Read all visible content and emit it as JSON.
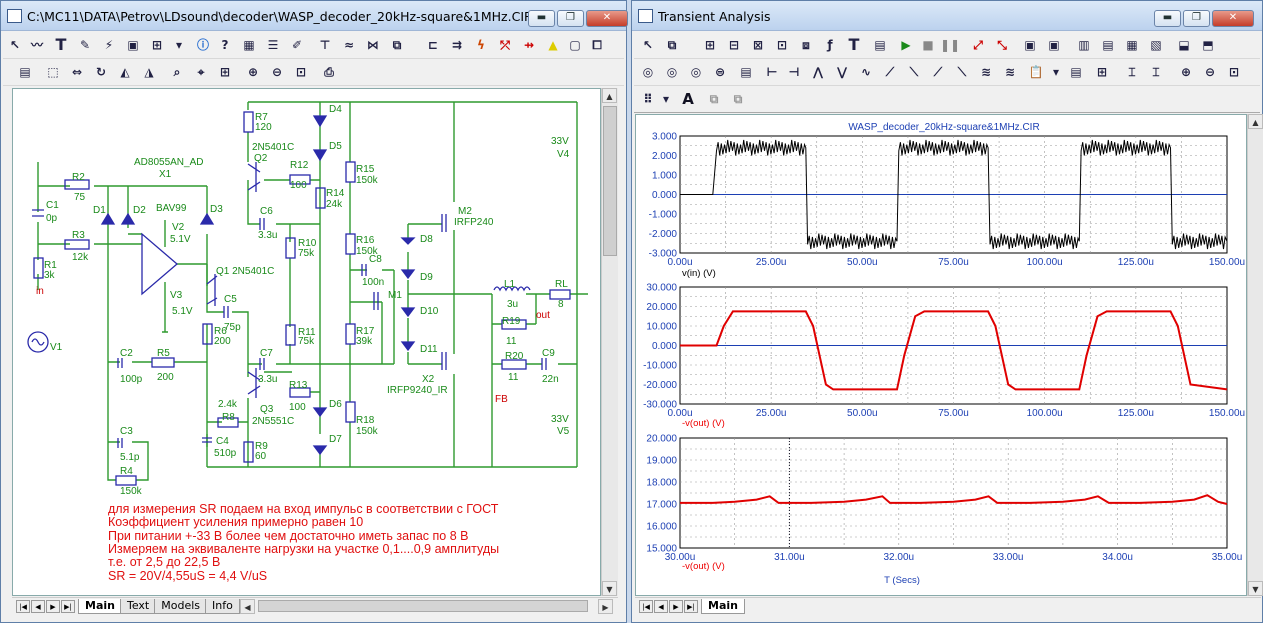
{
  "left_window": {
    "title": "C:\\MC11\\DATA\\Petrov\\LDsound\\decoder\\WASP_decoder_20kHz-square&1MHz.CIR",
    "tabs": [
      "Main",
      "Text",
      "Models",
      "Info"
    ],
    "controls": {
      "minimize": "▬",
      "restore": "❐",
      "close": "✕"
    },
    "labels": {
      "ad8055": "AD8055AN_AD",
      "x1": "X1",
      "r2": "R2",
      "r2v": "75",
      "c1": "C1",
      "c1v": "0p",
      "r3": "R3",
      "r3v": "12k",
      "r1": "R1",
      "r1v": "3k",
      "in": "in",
      "d1": "D1",
      "d2": "D2",
      "bav": "BAV99",
      "d3": "D3",
      "v2": "V2",
      "v2v": "5.1V",
      "v3": "V3",
      "v3v": "5.1V",
      "v1": "V1",
      "q1": "Q1 2N5401C",
      "r7": "R7",
      "r7v": "120",
      "q2": "Q2",
      "q2t": "2N5401C",
      "r12": "R12",
      "r12v": "100",
      "d4": "D4",
      "d5": "D5",
      "r15": "R15",
      "r15v": "150k",
      "r14": "R14",
      "r14v": "24k",
      "c6": "C6",
      "c6v": "3.3u",
      "r10": "R10",
      "r10v": "75k",
      "r16": "R16",
      "r16v": "150k",
      "c8": "C8",
      "c8v": "100n",
      "m1": "M1",
      "r17": "R17",
      "r17v": "39k",
      "r11": "R11",
      "r11v": "75k",
      "c5": "C5",
      "c5v": "75p",
      "r6": "R6",
      "r6v": "200",
      "c2": "C2",
      "c2v": "100p",
      "r5": "R5",
      "r5v": "200",
      "c7": "C7",
      "c7v": "3.3u",
      "r13": "R13",
      "r13v": "100",
      "d6": "D6",
      "d7": "D7",
      "r18": "R18",
      "r18v": "150k",
      "r8": "R8",
      "r8v": "2.4k",
      "q3": "Q3",
      "q3t": "2N5551C",
      "c4": "C4",
      "c4v": "510p",
      "r9": "R9",
      "r9v": "60",
      "c3": "C3",
      "c3v": "5.1p",
      "r4": "R4",
      "r4v": "150k",
      "m2": "M2",
      "m2t": "IRFP240",
      "d8": "D8",
      "d9": "D9",
      "d10": "D10",
      "d11": "D11",
      "x2": "X2",
      "x2t": "IRFP9240_IR",
      "fb": "FB",
      "l1": "L1",
      "l1v": "3u",
      "rl": "RL",
      "rlv": "8",
      "r19": "R19",
      "r19v": "11",
      "out": "out",
      "r20": "R20",
      "r20v": "11",
      "c9": "C9",
      "c9v": "22n",
      "v4": "33V",
      "v4n": "V4",
      "v5": "33V",
      "v5n": "V5"
    },
    "notes": [
      "для измерения SR подаем на вход импульс в соответствии с ГОСТ",
      "Коэффициент усиления примерно равен 10",
      "При питании +-33 В более чем достаточно иметь запас по 8 В",
      "Измеряем на эквиваленте нагрузки на участке 0,1....0,9 амплитуды",
      "т.е. от 2,5 до 22,5 В",
      "SR = 20V/4,55uS = 4,4 V/uS"
    ]
  },
  "right_window": {
    "title": "Transient Analysis",
    "tab": "Main",
    "controls": {
      "minimize": "▬",
      "restore": "❐",
      "close": "✕"
    }
  },
  "chart_data": [
    {
      "type": "line",
      "title": "WASP_decoder_20kHz-square&1MHz.CIR",
      "xlabel": "v(in) (V)",
      "xlim": [
        0,
        150
      ],
      "ylim": [
        -3,
        3
      ],
      "x_ticks": [
        "0.00u",
        "25.00u",
        "50.00u",
        "75.00u",
        "100.00u",
        "125.00u",
        "150.00u"
      ],
      "y_ticks": [
        "3.000",
        "2.000",
        "1.000",
        "0.000",
        "-1.000",
        "-2.000",
        "-3.000"
      ],
      "series": [
        {
          "name": "v(in)",
          "color": "#000000",
          "x": [
            0,
            9,
            10,
            34.5,
            35,
            59.5,
            60,
            84.5,
            85,
            109.5,
            110,
            134.5,
            135,
            150
          ],
          "y": [
            0,
            0,
            2.4,
            2.4,
            -2.4,
            -2.4,
            2.4,
            2.4,
            -2.4,
            -2.4,
            2.4,
            2.4,
            -2.4,
            -2.4
          ],
          "ripple": 0.4
        }
      ]
    },
    {
      "type": "line",
      "xlabel": "-v(out) (V)",
      "xlim": [
        0,
        150
      ],
      "ylim": [
        -30,
        30
      ],
      "x_ticks": [
        "0.00u",
        "25.00u",
        "50.00u",
        "75.00u",
        "100.00u",
        "125.00u",
        "150.00u"
      ],
      "y_ticks": [
        "30.000",
        "20.000",
        "10.000",
        "0.000",
        "-10.000",
        "-20.000",
        "-30.000"
      ],
      "series": [
        {
          "name": "-v(out)",
          "color": "#e00000",
          "x": [
            0,
            10,
            12,
            14.5,
            34.5,
            36.5,
            40,
            42,
            59.5,
            61.5,
            64.5,
            67,
            84.5,
            86.5,
            90,
            92,
            109.5,
            111.5,
            114.5,
            117,
            134.5,
            136.5,
            140,
            150
          ],
          "y": [
            0,
            0,
            10,
            17.5,
            17.5,
            10,
            -20,
            -22.5,
            -22.5,
            -5,
            15,
            17.5,
            17.5,
            10,
            -20,
            -22.5,
            -22.5,
            -5,
            15,
            17.5,
            17.5,
            10,
            -20,
            -22.5
          ]
        }
      ]
    },
    {
      "type": "line",
      "xlabel": "-v(out) (V)",
      "footer": "T (Secs)",
      "xlim": [
        30,
        35
      ],
      "ylim": [
        15,
        20
      ],
      "x_ticks": [
        "30.00u",
        "31.00u",
        "32.00u",
        "33.00u",
        "34.00u",
        "35.00u"
      ],
      "y_ticks": [
        "20.000",
        "19.000",
        "18.000",
        "17.000",
        "16.000",
        "15.000"
      ],
      "series": [
        {
          "name": "-v(out)",
          "color": "#e00000",
          "x": [
            30,
            30.3,
            30.5,
            30.7,
            30.82,
            30.9,
            31.2,
            31.5,
            31.7,
            31.85,
            31.92,
            32.2,
            32.5,
            32.7,
            32.82,
            32.9,
            33.2,
            33.5,
            33.7,
            33.82,
            33.92,
            34.2,
            34.5,
            34.7,
            34.82,
            34.92,
            35
          ],
          "y": [
            17.05,
            17.05,
            17.1,
            17.2,
            17.35,
            17.05,
            17.05,
            17.1,
            17.2,
            17.35,
            17.05,
            17.05,
            17.1,
            17.2,
            17.35,
            17.05,
            17.05,
            17.1,
            17.2,
            17.35,
            17.05,
            17.05,
            17.1,
            17.2,
            17.4,
            17.1,
            17.0
          ]
        }
      ],
      "cursor_x": 31.0
    }
  ]
}
